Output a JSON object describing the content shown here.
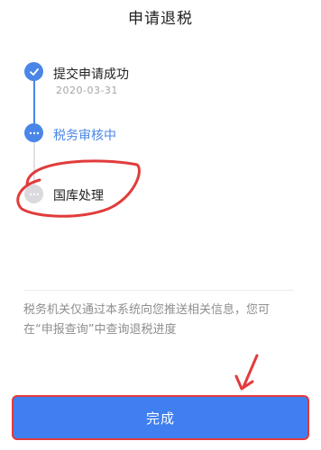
{
  "header": {
    "title": "申请退税"
  },
  "timeline": {
    "steps": [
      {
        "label": "提交申请成功",
        "date": "2020-03-31",
        "status": "done",
        "icon": "check-icon"
      },
      {
        "label": "税务审核中",
        "status": "active",
        "icon": "ellipsis-icon"
      },
      {
        "label": "国库处理",
        "status": "pending",
        "icon": "ellipsis-icon"
      }
    ]
  },
  "notice": {
    "text": "税务机关仅通过本系统向您推送相关信息，您可在“申报查询”中查询退税进度"
  },
  "actions": {
    "complete_label": "完成"
  },
  "colors": {
    "accent": "#4a86e8",
    "button": "#3f7ff0",
    "annotation": "#e23b3b",
    "muted": "#8e8e8e"
  }
}
